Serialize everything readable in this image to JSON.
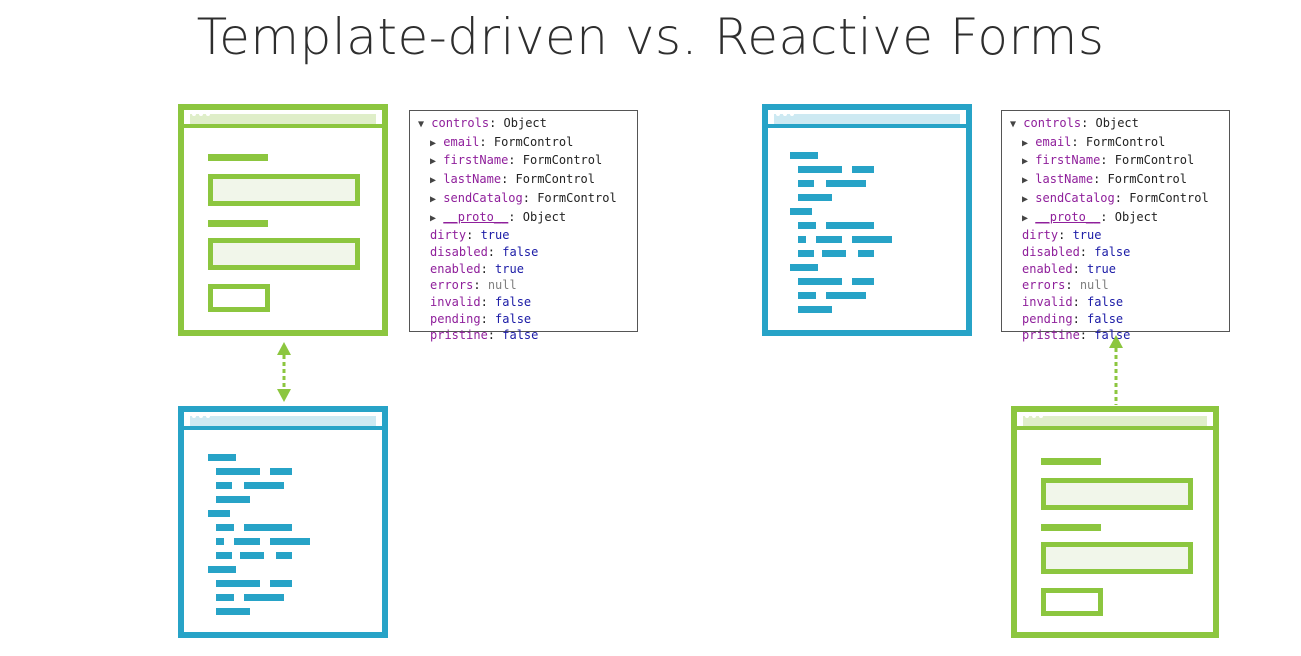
{
  "title": "Template-driven vs. Reactive Forms",
  "colors": {
    "green": "#8cc63f",
    "blue": "#27a3c7",
    "key": "#8f1f9b",
    "bool": "#1a1aa6",
    "null": "#808080"
  },
  "panel": {
    "header": {
      "key": "controls",
      "value": "Object"
    },
    "children": [
      {
        "key": "email",
        "value": "FormControl"
      },
      {
        "key": "firstName",
        "value": "FormControl"
      },
      {
        "key": "lastName",
        "value": "FormControl"
      },
      {
        "key": "sendCatalog",
        "value": "FormControl"
      },
      {
        "key": "__proto__",
        "value": "Object"
      }
    ],
    "props": [
      {
        "key": "dirty",
        "value": "true"
      },
      {
        "key": "disabled",
        "value": "false"
      },
      {
        "key": "enabled",
        "value": "true"
      },
      {
        "key": "errors",
        "value": "null"
      },
      {
        "key": "invalid",
        "value": "false"
      },
      {
        "key": "pending",
        "value": "false"
      },
      {
        "key": "pristine",
        "value": "false"
      }
    ]
  },
  "icons": {
    "expanded": "triangle-down-icon",
    "collapsed": "triangle-right-icon",
    "sync": "double-arrow-icon",
    "flow": "up-arrow-icon"
  }
}
